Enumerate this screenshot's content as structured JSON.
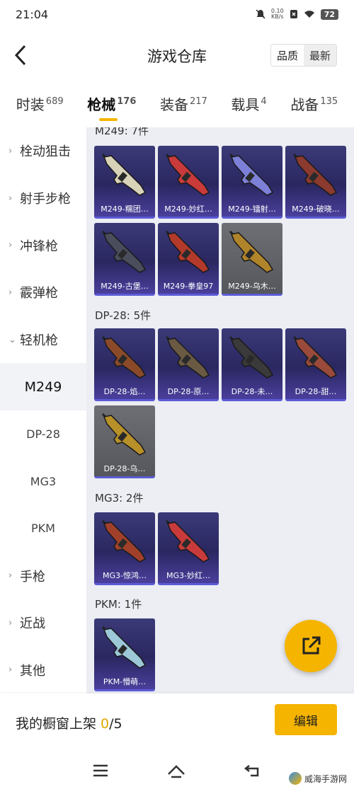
{
  "status_bar": {
    "time": "21:04",
    "net_speed_value": "0.10",
    "net_speed_unit": "KB/s",
    "battery": "72"
  },
  "header": {
    "title": "游戏仓库",
    "sort_quality": "品质",
    "sort_latest": "最新"
  },
  "tabs": [
    {
      "label": "时装",
      "count": "689"
    },
    {
      "label": "枪械",
      "count": "176"
    },
    {
      "label": "装备",
      "count": "217"
    },
    {
      "label": "载具",
      "count": "4"
    },
    {
      "label": "战备",
      "count": "135"
    }
  ],
  "sidebar": {
    "items": [
      {
        "label": "栓动狙击"
      },
      {
        "label": "射手步枪"
      },
      {
        "label": "冲锋枪"
      },
      {
        "label": "霰弹枪"
      },
      {
        "label": "轻机枪"
      },
      {
        "label": "M249"
      },
      {
        "label": "DP-28"
      },
      {
        "label": "MG3"
      },
      {
        "label": "PKM"
      },
      {
        "label": "手枪"
      },
      {
        "label": "近战"
      },
      {
        "label": "其他"
      }
    ]
  },
  "groups": [
    {
      "title": "M249: 7件",
      "cards": [
        {
          "label": "M249-糯团…",
          "color": "#d8d2b8",
          "rarity": "purple"
        },
        {
          "label": "M249-妙红…",
          "color": "#c93b3b",
          "rarity": "purple"
        },
        {
          "label": "M249-镭射…",
          "color": "#7d80d8",
          "rarity": "purple"
        },
        {
          "label": "M249-破晓…",
          "color": "#8a3a2e",
          "rarity": "purple"
        },
        {
          "label": "M249-古堡…",
          "color": "#4a4e5c",
          "rarity": "purple"
        },
        {
          "label": "M249-拳皇97",
          "color": "#b33a2a",
          "rarity": "purple"
        },
        {
          "label": "M249-乌木…",
          "color": "#b0842a",
          "rarity": "grey"
        }
      ]
    },
    {
      "title": "DP-28: 5件",
      "cards": [
        {
          "label": "DP-28-焰…",
          "color": "#8a4a2a",
          "rarity": "purple"
        },
        {
          "label": "DP-28-原…",
          "color": "#6a5a44",
          "rarity": "purple"
        },
        {
          "label": "DP-28-未…",
          "color": "#3a3a3a",
          "rarity": "purple"
        },
        {
          "label": "DP-28-甜…",
          "color": "#9a4a3a",
          "rarity": "purple"
        },
        {
          "label": "DP-28-乌…",
          "color": "#b8902a",
          "rarity": "grey"
        }
      ]
    },
    {
      "title": "MG3: 2件",
      "cards": [
        {
          "label": "MG3-惊鸿…",
          "color": "#a0402a",
          "rarity": "purple"
        },
        {
          "label": "MG3-妙红…",
          "color": "#c93b3b",
          "rarity": "purple"
        }
      ]
    },
    {
      "title": "PKM: 1件",
      "cards": [
        {
          "label": "PKM-懵萌…",
          "color": "#9cc8d8",
          "rarity": "purple"
        }
      ]
    }
  ],
  "bottom_bar": {
    "shelf_label": "我的橱窗上架 ",
    "shelf_current": "0",
    "shelf_total": "/5",
    "edit_label": "编辑"
  },
  "watermark": {
    "text": "威海手游网"
  },
  "colors": {
    "accent": "#f5b400",
    "card_purple": "#2a2760",
    "card_grey": "#5f6166",
    "content_bg": "#eceef3"
  }
}
